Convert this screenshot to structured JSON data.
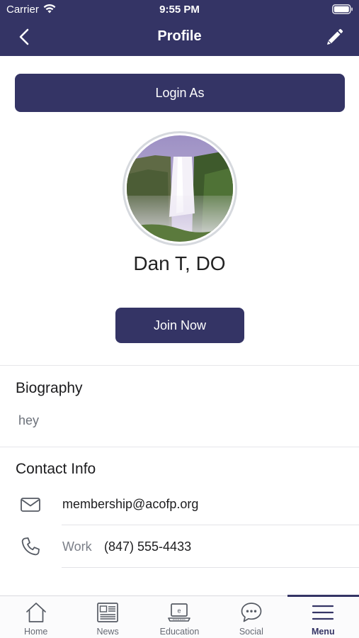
{
  "status_bar": {
    "carrier": "Carrier",
    "time": "9:55 PM"
  },
  "header": {
    "title": "Profile",
    "back_icon": "chevron-left-icon",
    "edit_icon": "pencil-icon"
  },
  "login_button": {
    "label": "Login As"
  },
  "profile": {
    "name": "Dan T, DO",
    "avatar_icon": "waterfall-photo"
  },
  "join_button": {
    "label": "Join Now"
  },
  "biography": {
    "title": "Biography",
    "text": "hey"
  },
  "contact": {
    "title": "Contact Info",
    "items": [
      {
        "icon": "mail-icon",
        "label": "",
        "value": "membership@acofp.org"
      },
      {
        "icon": "phone-icon",
        "label": "Work",
        "value": "(847) 555-4433"
      }
    ]
  },
  "tabs": [
    {
      "label": "Home",
      "icon": "house-icon",
      "active": false
    },
    {
      "label": "News",
      "icon": "newspaper-icon",
      "active": false
    },
    {
      "label": "Education",
      "icon": "laptop-icon",
      "active": false
    },
    {
      "label": "Social",
      "icon": "speech-bubble-icon",
      "active": false
    },
    {
      "label": "Menu",
      "icon": "hamburger-icon",
      "active": true
    }
  ],
  "colors": {
    "brand": "#343465",
    "background": "#ffffff",
    "muted_text": "#6c717a"
  }
}
